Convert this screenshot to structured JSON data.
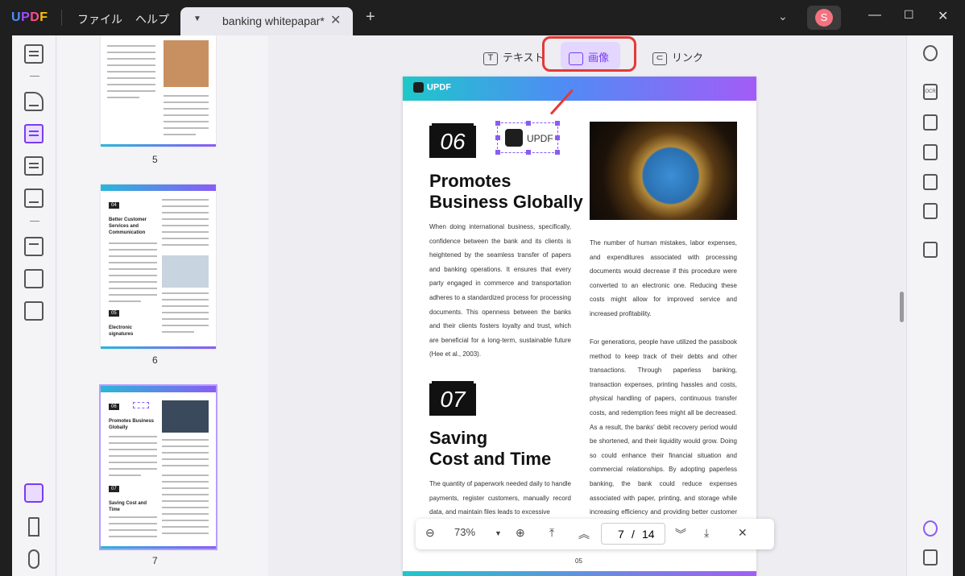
{
  "titlebar": {
    "logo": "UPDF",
    "menu": [
      "ファイル",
      "ヘルプ"
    ],
    "tab_title": "banking whitepapar*",
    "avatar_letter": "S"
  },
  "thumbnails": {
    "page_numbers": [
      "5",
      "6",
      "7"
    ],
    "page6": {
      "num1": "04",
      "title1": "Better Customer Services and Communication",
      "num2": "05",
      "title2": "Electronic signatures"
    },
    "page7": {
      "num1": "06",
      "title1": "Promotes Business Globally",
      "num2": "07",
      "title2": "Saving Cost and Time"
    }
  },
  "toolbar": {
    "text": "テキスト",
    "image": "画像",
    "link": "リンク"
  },
  "page": {
    "logo": "UPDF",
    "num06": "06",
    "img_label": "UPDF",
    "head1_l1": "Promotes",
    "head1_l2": "Business Globally",
    "para1": "When doing international business, specifically, confidence between the bank and its clients is heightened by the seamless transfer of papers and banking operations. It ensures that every party engaged in commerce and transportation adheres to a standardized process for processing documents. This openness between the banks and their clients fosters loyalty and trust, which are beneficial for a long-term, sustainable future (Hee et al., 2003).",
    "num07": "07",
    "head2_l1": "Saving",
    "head2_l2": "Cost and Time",
    "para2": "The quantity of paperwork needed daily to handle payments, register customers, manually record data, and maintain files leads to excessive",
    "right1": "The number of human mistakes, labor expenses, and expenditures associated with processing documents would decrease if this procedure were converted to an electronic one. Reducing these costs might allow for improved service and increased profitability.",
    "right2": "For generations, people have utilized the passbook method to keep track of their debts and other transactions. Through paperless banking, transaction expenses, printing hassles and costs, physical handling of papers, continuous transfer costs, and redemption fees might all be decreased. As a result, the banks' debit recovery period would be shortened, and their liquidity would grow. Doing so could enhance their financial situation and commercial relationships. By adopting paperless banking, the bank could reduce expenses associated with paper, printing, and storage while increasing efficiency and providing better customer service (Kumari,",
    "page_no": "05"
  },
  "zoom": {
    "level": "73%",
    "current": "7",
    "sep": "/",
    "total": "14"
  },
  "colors": {
    "accent": "#7a3cf0",
    "highlight": "#e53935"
  }
}
